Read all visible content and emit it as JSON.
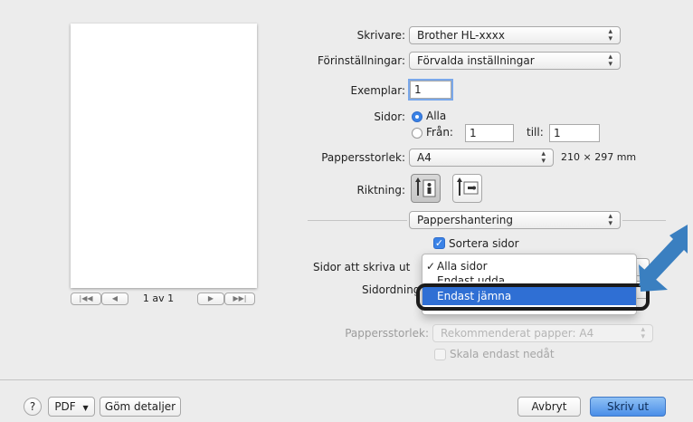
{
  "preview": {
    "page_indicator": "1 av 1"
  },
  "printer": {
    "label": "Skrivare:",
    "value": "Brother HL-xxxx"
  },
  "presets": {
    "label": "Förinställningar:",
    "value": "Förvalda inställningar"
  },
  "copies": {
    "label": "Exemplar:",
    "value": "1"
  },
  "pages": {
    "label": "Sidor:",
    "all_label": "Alla",
    "from_label": "Från:",
    "from_value": "1",
    "to_label": "till:",
    "to_value": "1"
  },
  "paper_size": {
    "label": "Pappersstorlek:",
    "value": "A4",
    "dimensions": "210 × 297 mm"
  },
  "orientation": {
    "label": "Riktning:"
  },
  "section": {
    "value": "Pappershantering"
  },
  "collate": {
    "label": "Sortera sidor",
    "checked": true
  },
  "pages_to_print": {
    "label": "Sidor att skriva ut",
    "menu": {
      "items": [
        "Alla sidor",
        "Endast udda",
        "Endast jämna"
      ],
      "checked": "Alla sidor",
      "highlighted": "Endast jämna"
    }
  },
  "page_order": {
    "label": "Sidordning"
  },
  "dest_paper": {
    "label": "Pappersstorlek:",
    "value": "Rekommenderat papper: A4"
  },
  "scale_down": {
    "label": "Skala endast nedåt"
  },
  "footer": {
    "help": "?",
    "pdf": "PDF",
    "hide_details": "Göm detaljer",
    "cancel": "Avbryt",
    "print": "Skriv ut"
  },
  "colors": {
    "accent": "#2f6fd4",
    "annotation_arrow": "#3a7fc0"
  }
}
